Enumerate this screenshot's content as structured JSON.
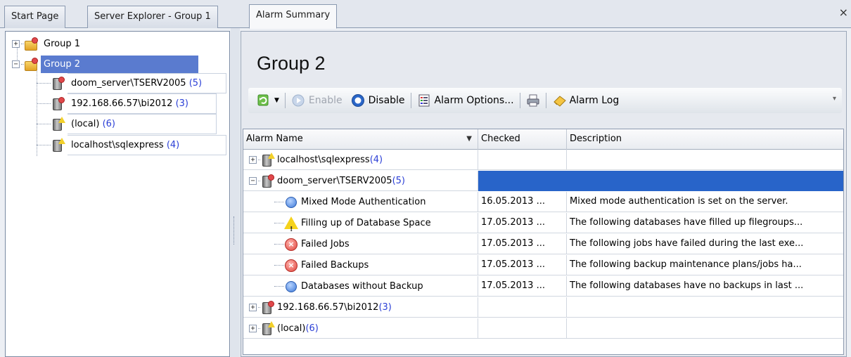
{
  "tabs": [
    {
      "label": "Start Page"
    },
    {
      "label": "Server Explorer - Group 1"
    },
    {
      "label": "Alarm Summary"
    }
  ],
  "close_label": "×",
  "tree": {
    "group1": {
      "label": "Group 1"
    },
    "group2": {
      "label": "Group 2"
    },
    "servers": [
      {
        "name": "doom_server\\TSERV2005",
        "count": "(5)",
        "status": "error"
      },
      {
        "name": "192.168.66.57\\bi2012",
        "count": "(3)",
        "status": "error"
      },
      {
        "name": "(local)",
        "count": "(6)",
        "status": "warning"
      },
      {
        "name": "localhost\\sqlexpress",
        "count": "(4)",
        "status": "warning"
      }
    ]
  },
  "main": {
    "title": "Group 2",
    "toolbar": {
      "enable_label": "Enable",
      "disable_label": "Disable",
      "alarm_options_label": "Alarm Options...",
      "alarm_log_label": "Alarm Log"
    },
    "grid": {
      "columns": [
        "Alarm Name",
        "Checked",
        "Description"
      ],
      "rows": [
        {
          "kind": "server",
          "name": "localhost\\sqlexpress",
          "count": "(4)",
          "expanded": false,
          "status": "warning"
        },
        {
          "kind": "server",
          "name": "doom_server\\TSERV2005",
          "count": "(5)",
          "expanded": true,
          "status": "error",
          "selected": true
        },
        {
          "kind": "alarm",
          "icon": "info",
          "name": "Mixed Mode Authentication",
          "checked": "16.05.2013 ...",
          "description": "Mixed mode authentication is set on the server."
        },
        {
          "kind": "alarm",
          "icon": "warning",
          "name": "Filling up of Database Space",
          "checked": "17.05.2013 ...",
          "description": "The following databases have filled up filegroups..."
        },
        {
          "kind": "alarm",
          "icon": "error",
          "name": "Failed Jobs",
          "checked": "17.05.2013 ...",
          "description": "The following jobs have failed during the last exe..."
        },
        {
          "kind": "alarm",
          "icon": "error",
          "name": "Failed Backups",
          "checked": "17.05.2013 ...",
          "description": "The following backup maintenance plans/jobs ha..."
        },
        {
          "kind": "alarm",
          "icon": "info",
          "name": "Databases without Backup",
          "checked": "17.05.2013 ...",
          "description": "The following databases have no backups in last ..."
        },
        {
          "kind": "server",
          "name": "192.168.66.57\\bi2012",
          "count": "(3)",
          "expanded": false,
          "status": "error"
        },
        {
          "kind": "server",
          "name": "(local)",
          "count": "(6)",
          "expanded": false,
          "status": "warning"
        }
      ]
    }
  },
  "colors": {
    "selection": "#5a7bcf",
    "grid_selection": "#2864c9",
    "count_text": "#2b3fd6"
  }
}
